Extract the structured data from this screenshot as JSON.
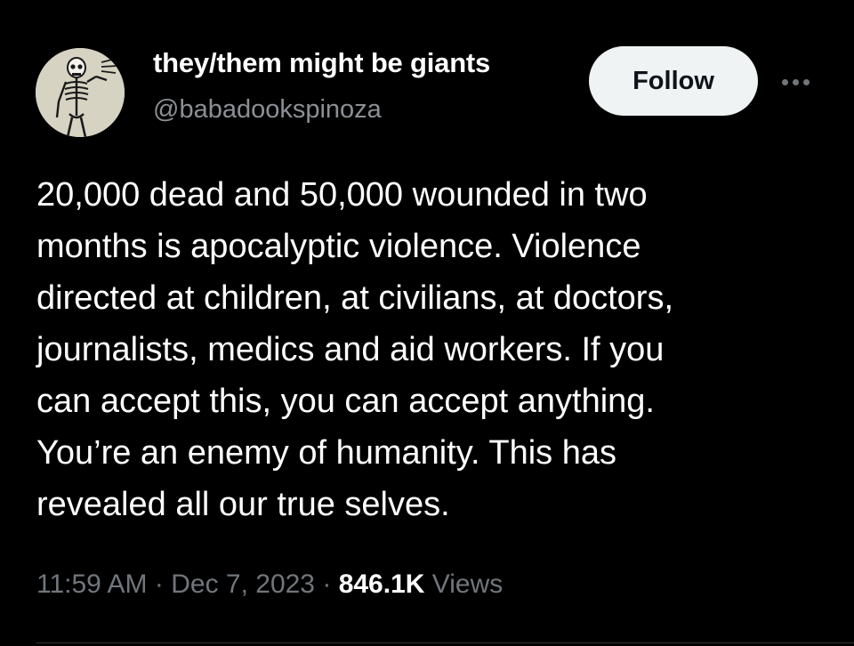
{
  "author": {
    "display_name": "they/them might be giants",
    "handle": "@babadookspinoza",
    "avatar_icon": "skeleton-avatar-icon"
  },
  "actions": {
    "follow_label": "Follow",
    "more_icon": "more-options-icon"
  },
  "tweet": {
    "lines": [
      "20,000 dead and 50,000 wounded in two",
      "months is apocalyptic violence. Violence",
      "directed at children, at civilians, at doctors,",
      "journalists, medics and aid workers. If you",
      "can accept this, you can accept anything.",
      "You’re an enemy of humanity. This has",
      "revealed all our true selves."
    ]
  },
  "meta": {
    "time": "11:59 AM",
    "separator": "·",
    "date": "Dec 7, 2023",
    "views_count": "846.1K",
    "views_label": "Views"
  },
  "colors": {
    "background": "#000000",
    "text_primary": "#ffffff",
    "text_secondary": "#71767b",
    "button_bg": "#eff3f4"
  }
}
